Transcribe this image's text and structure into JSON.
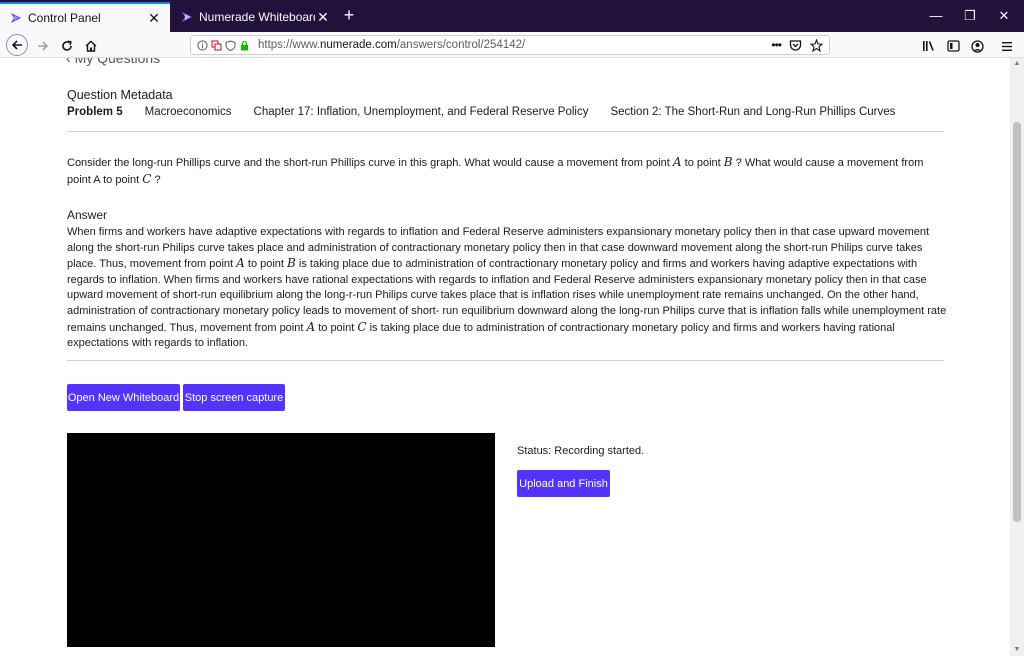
{
  "browser": {
    "tabs": [
      {
        "label": "Control Panel",
        "active": true
      },
      {
        "label": "Numerade Whiteboard",
        "active": false
      }
    ],
    "url_prefix": "https://www.",
    "url_domain": "numerade.com",
    "url_path": "/answers/control/254142/"
  },
  "header": {
    "back_label": "My Questions"
  },
  "metadata": {
    "title": "Question Metadata",
    "problem": "Problem 5",
    "subject": "Macroeconomics",
    "chapter": "Chapter 17: Inflation, Unemployment, and Federal Reserve Policy",
    "section": "Section 2: The Short-Run and Long-Run Phillips Curves"
  },
  "question": {
    "p1": "Consider the long-run Phillips curve and the short-run Phillips curve in this graph. What would cause a movement from point ",
    "a": "A",
    "p2": " to point ",
    "b": "B",
    "p3": " ? What would cause a movement from point A to point ",
    "c": "C",
    "p4": " ?"
  },
  "answer": {
    "title": "Answer",
    "t1": "When firms and workers have adaptive expectations with regards to inflation and Federal Reserve administers expansionary monetary policy then in that case upward movement along the short-run Philips curve takes place and administration of contractionary monetary policy then in that case downward movement along the short-run Philips curve takes place. Thus, movement from point ",
    "a1": "A",
    "t2": " to point ",
    "b1": "B",
    "t3": " is taking place due to administration of contractionary monetary policy and firms and workers having adaptive expectations with regards to inflation. When firms and workers have rational expectations with regards to inflation and Federal Reserve administers expansionary monetary policy then in that case upward movement of short-run equilibrium along the long-r-run Philips curve takes place that is inflation rises while unemployment rate remains unchanged. On the other hand, administration of contractionary monetary policy leads to movement of short- run equilibrium downward along the long-run Philips curve that is inflation falls while unemployment rate remains unchanged. Thus, movement from point ",
    "a2": "A",
    "t4": " to point ",
    "c1": "C",
    "t5": " is taking place due to administration of contractionary monetary policy and firms and workers having rational expectations with regards to inflation."
  },
  "actions": {
    "open_whiteboard": "Open New Whiteboard",
    "stop_capture": "Stop screen capture",
    "upload_finish": "Upload and Finish"
  },
  "status_text": "Status: Recording started.",
  "colors": {
    "accent": "#5533ff",
    "tabbar": "#20123a"
  }
}
